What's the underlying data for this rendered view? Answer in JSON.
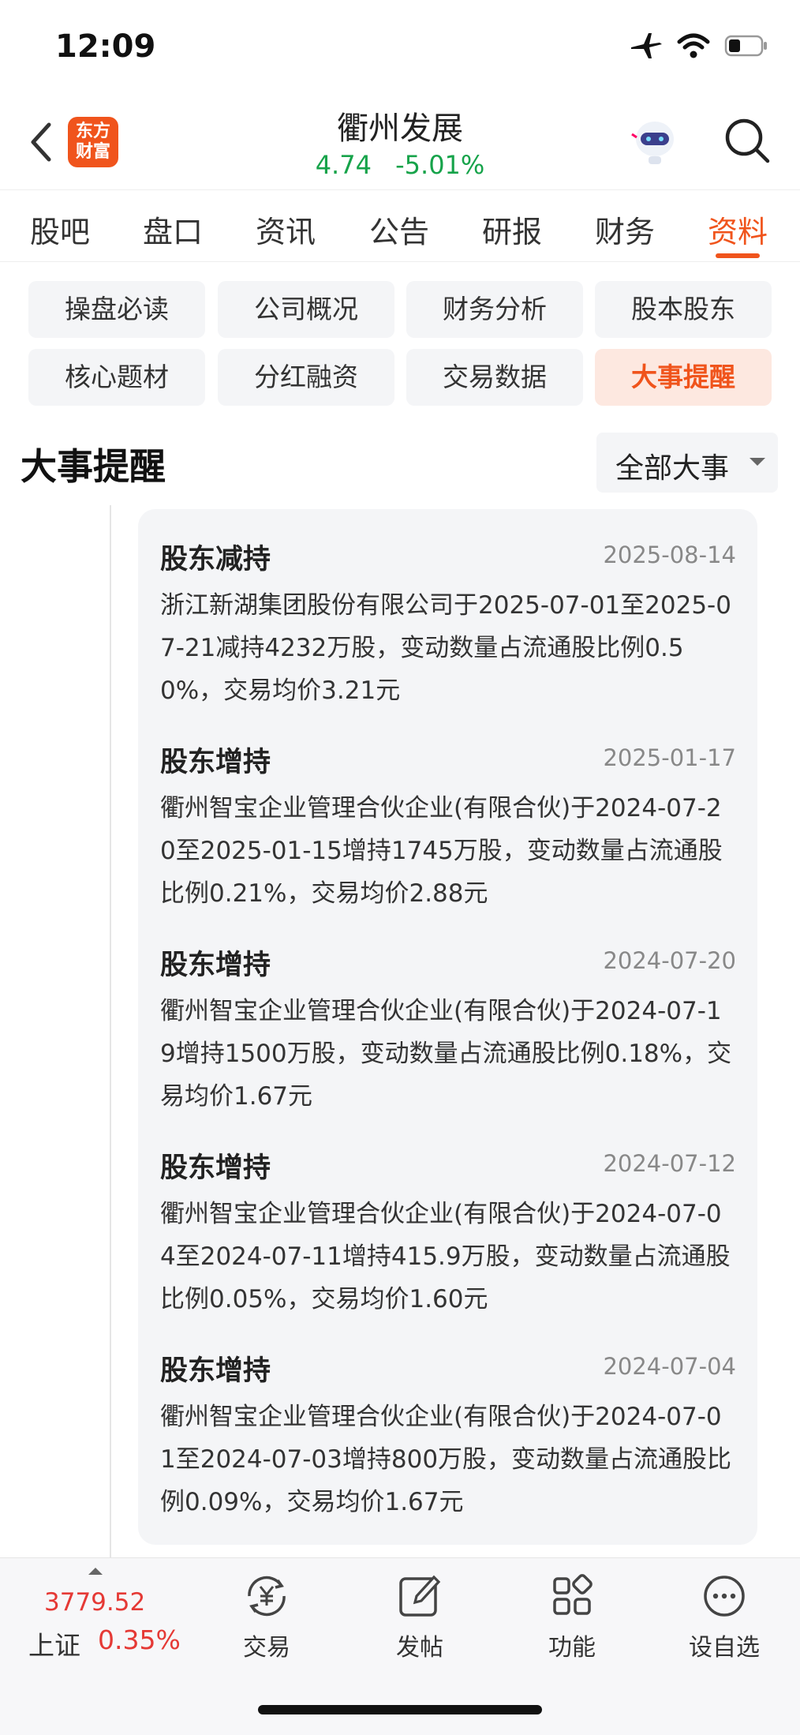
{
  "status_bar": {
    "time": "12:09"
  },
  "header": {
    "logo_text_line1": "东方",
    "logo_text_line2": "财富",
    "stock_name": "衢州发展",
    "price": "4.74",
    "change_pct": "-5.01%",
    "quote_color": "#16a34a"
  },
  "tabs": [
    {
      "label": "股吧"
    },
    {
      "label": "盘口"
    },
    {
      "label": "资讯"
    },
    {
      "label": "公告"
    },
    {
      "label": "研报"
    },
    {
      "label": "财务"
    },
    {
      "label": "资料",
      "active": true
    }
  ],
  "subnav": [
    {
      "label": "操盘必读"
    },
    {
      "label": "公司概况"
    },
    {
      "label": "财务分析"
    },
    {
      "label": "股本股东"
    },
    {
      "label": "核心题材"
    },
    {
      "label": "分红融资"
    },
    {
      "label": "交易数据"
    },
    {
      "label": "大事提醒",
      "active": true
    }
  ],
  "section": {
    "title": "大事提醒",
    "filter_label": "全部大事"
  },
  "events": [
    {
      "title": "股东减持",
      "date": "2025-08-14",
      "desc": "浙江新湖集团股份有限公司于2025-07-01至2025-07-21减持4232万股，变动数量占流通股比例0.50%，交易均价3.21元"
    },
    {
      "title": "股东增持",
      "date": "2025-01-17",
      "desc": "衢州智宝企业管理合伙企业(有限合伙)于2024-07-20至2025-01-15增持1745万股，变动数量占流通股比例0.21%，交易均价2.88元"
    },
    {
      "title": "股东增持",
      "date": "2024-07-20",
      "desc": "衢州智宝企业管理合伙企业(有限合伙)于2024-07-19增持1500万股，变动数量占流通股比例0.18%，交易均价1.67元"
    },
    {
      "title": "股东增持",
      "date": "2024-07-12",
      "desc": "衢州智宝企业管理合伙企业(有限合伙)于2024-07-04至2024-07-11增持415.9万股，变动数量占流通股比例0.05%，交易均价1.60元"
    },
    {
      "title": "股东增持",
      "date": "2024-07-04",
      "desc": "衢州智宝企业管理合伙企业(有限合伙)于2024-07-01至2024-07-03增持800万股，变动数量占流通股比例0.09%，交易均价1.67元"
    }
  ],
  "bottom_bar": {
    "index_value": "3779.52",
    "index_name": "上证",
    "index_change": "0.35%",
    "nav": [
      {
        "label": "交易",
        "icon": "yuan-exchange-icon"
      },
      {
        "label": "发帖",
        "icon": "edit-post-icon"
      },
      {
        "label": "功能",
        "icon": "grid-apps-icon"
      },
      {
        "label": "设自选",
        "icon": "more-dots-icon"
      }
    ]
  },
  "colors": {
    "accent": "#f0541c",
    "up": "#e53935",
    "down": "#16a34a"
  }
}
